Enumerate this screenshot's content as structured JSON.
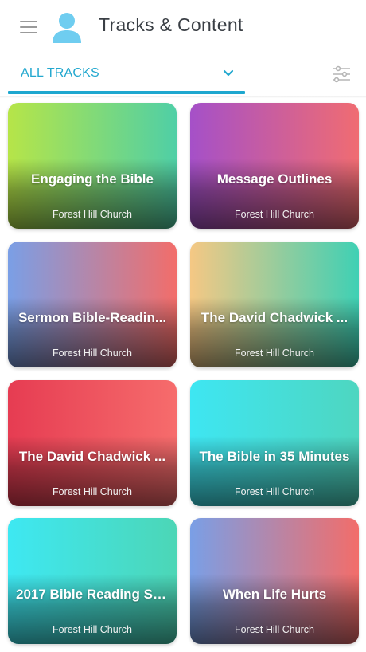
{
  "header": {
    "title": "Tracks & Content",
    "menu_icon": "hamburger-menu-icon",
    "avatar_icon": "user-avatar-icon"
  },
  "tabbar": {
    "active_tab": "ALL TRACKS",
    "dropdown_icon": "chevron-down-icon",
    "filter_icon": "filter-sliders-icon",
    "accent_color": "#1ea7cf"
  },
  "cards": [
    {
      "title": "Engaging the Bible",
      "subtitle": "Forest Hill Church",
      "colors": [
        "#b6e548",
        "#4fcfa6"
      ]
    },
    {
      "title": "Message Outlines",
      "subtitle": "Forest Hill Church",
      "colors": [
        "#a550c8",
        "#f06c72"
      ]
    },
    {
      "title": "Sermon Bible-Readin...",
      "subtitle": "Forest Hill Church",
      "colors": [
        "#7a9fe6",
        "#f26d6a"
      ]
    },
    {
      "title": "The David Chadwick ...",
      "subtitle": "Forest Hill Church",
      "colors": [
        "#f5c884",
        "#3fd0b4"
      ]
    },
    {
      "title": "The David Chadwick ...",
      "subtitle": "Forest Hill Church",
      "colors": [
        "#e63c52",
        "#f66c6c"
      ]
    },
    {
      "title": "The Bible in 35 Minutes",
      "subtitle": "Forest Hill Church",
      "colors": [
        "#3ee6f2",
        "#4ed6c0"
      ]
    },
    {
      "title": "2017 Bible Reading Sc...",
      "subtitle": "Forest Hill Church",
      "colors": [
        "#3ee8f2",
        "#4cd6b6"
      ]
    },
    {
      "title": "When Life Hurts",
      "subtitle": "Forest Hill Church",
      "colors": [
        "#7a9fe6",
        "#f26d6a"
      ]
    }
  ]
}
